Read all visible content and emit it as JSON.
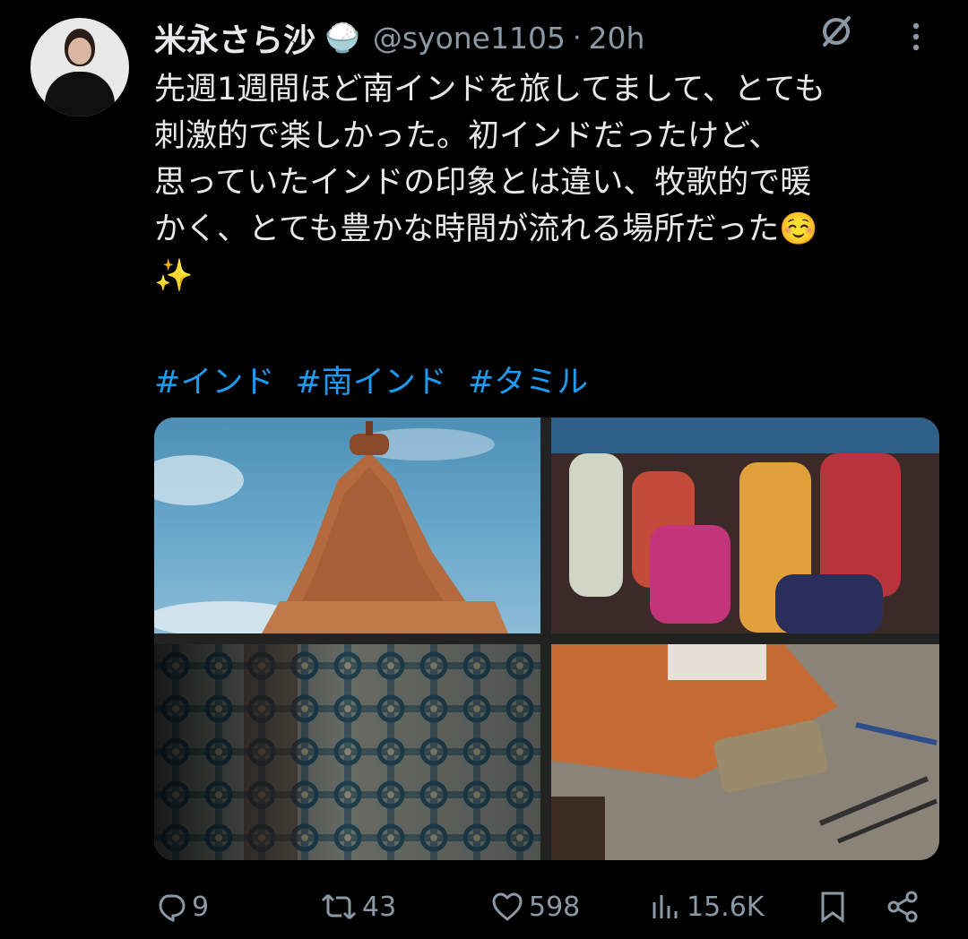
{
  "author": {
    "name": "米永さら沙",
    "badge_emoji": "🍚",
    "handle": "@syone1105",
    "separator": "·",
    "time": "20h"
  },
  "tweet": {
    "lines": [
      "先週1週間ほど南インドを旅してまして、とても",
      "刺激的で楽しかった。初インドだったけど、",
      "思っていたインドの印象とは違い、牧歌的で暖",
      "かく、とても豊かな時間が流れる場所だった☺️",
      "✨"
    ],
    "hashtags": [
      "#インド",
      "#南インド",
      "#タミル"
    ]
  },
  "media": [
    {
      "description_icon": "temple-photo"
    },
    {
      "description_icon": "women-in-saris-photo"
    },
    {
      "description_icon": "patterned-tiles-photo"
    },
    {
      "description_icon": "craftsman-tools-photo"
    }
  ],
  "actions": {
    "replies": "9",
    "reposts": "43",
    "likes": "598",
    "views": "15.6K"
  },
  "colors": {
    "background": "#000000",
    "text": "#e7e9ea",
    "muted": "#8b98a5",
    "link": "#1d9bf0"
  }
}
